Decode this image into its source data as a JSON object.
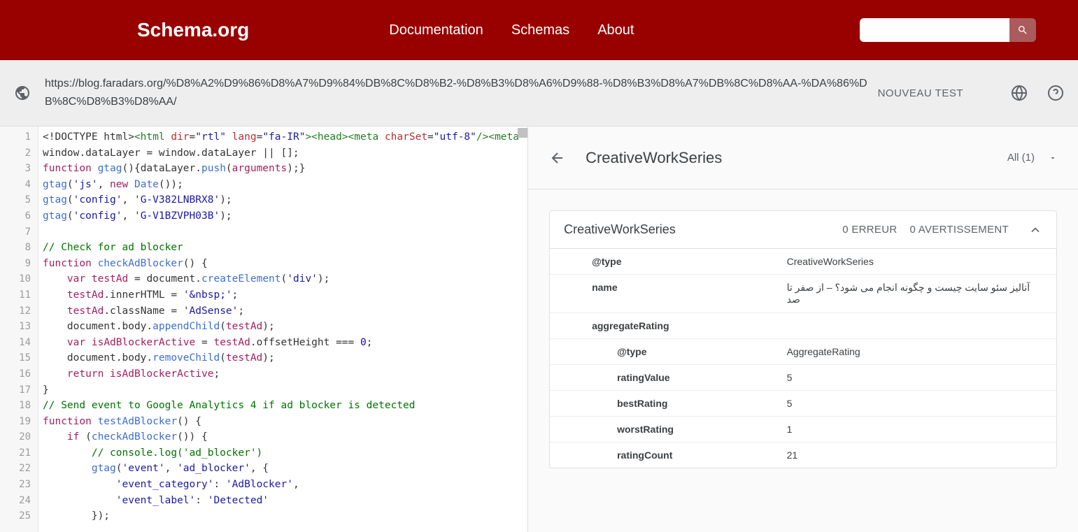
{
  "header": {
    "logo": "Schema.org",
    "nav": [
      "Documentation",
      "Schemas",
      "About"
    ]
  },
  "toolbar": {
    "url": "https://blog.faradars.org/%D8%A2%D9%86%D8%A7%D9%84%DB%8C%D8%B2-%D8%B3%D8%A6%D9%88-%D8%B3%D8%A7%DB%8C%D8%AA-%DA%86%DB%8C%D8%B3%D8%AA/",
    "new_test": "NOUVEAU TEST"
  },
  "code": {
    "lines": [
      "1",
      "2",
      "3",
      "4",
      "5",
      "6",
      "7",
      "8",
      "9",
      "10",
      "11",
      "12",
      "13",
      "14",
      "15",
      "16",
      "17",
      "18",
      "19",
      "20",
      "21",
      "22",
      "23",
      "24",
      "25"
    ]
  },
  "results": {
    "title": "CreativeWorkSeries",
    "filter": "All (1)",
    "card": {
      "title": "CreativeWorkSeries",
      "errors": "0 ERREUR",
      "warnings": "0 AVERTISSEMENT",
      "rows": [
        {
          "k": "@type",
          "v": "CreativeWorkSeries",
          "indent": 1
        },
        {
          "k": "name",
          "v": "آنالیز سئو سایت چیست و چگونه انجام می شود؟ – از صفر تا صد",
          "indent": 1,
          "rtl": true
        },
        {
          "k": "aggregateRating",
          "v": "",
          "indent": 1
        },
        {
          "k": "@type",
          "v": "AggregateRating",
          "indent": 2
        },
        {
          "k": "ratingValue",
          "v": "5",
          "indent": 2
        },
        {
          "k": "bestRating",
          "v": "5",
          "indent": 2
        },
        {
          "k": "worstRating",
          "v": "1",
          "indent": 2
        },
        {
          "k": "ratingCount",
          "v": "21",
          "indent": 2
        }
      ]
    }
  }
}
